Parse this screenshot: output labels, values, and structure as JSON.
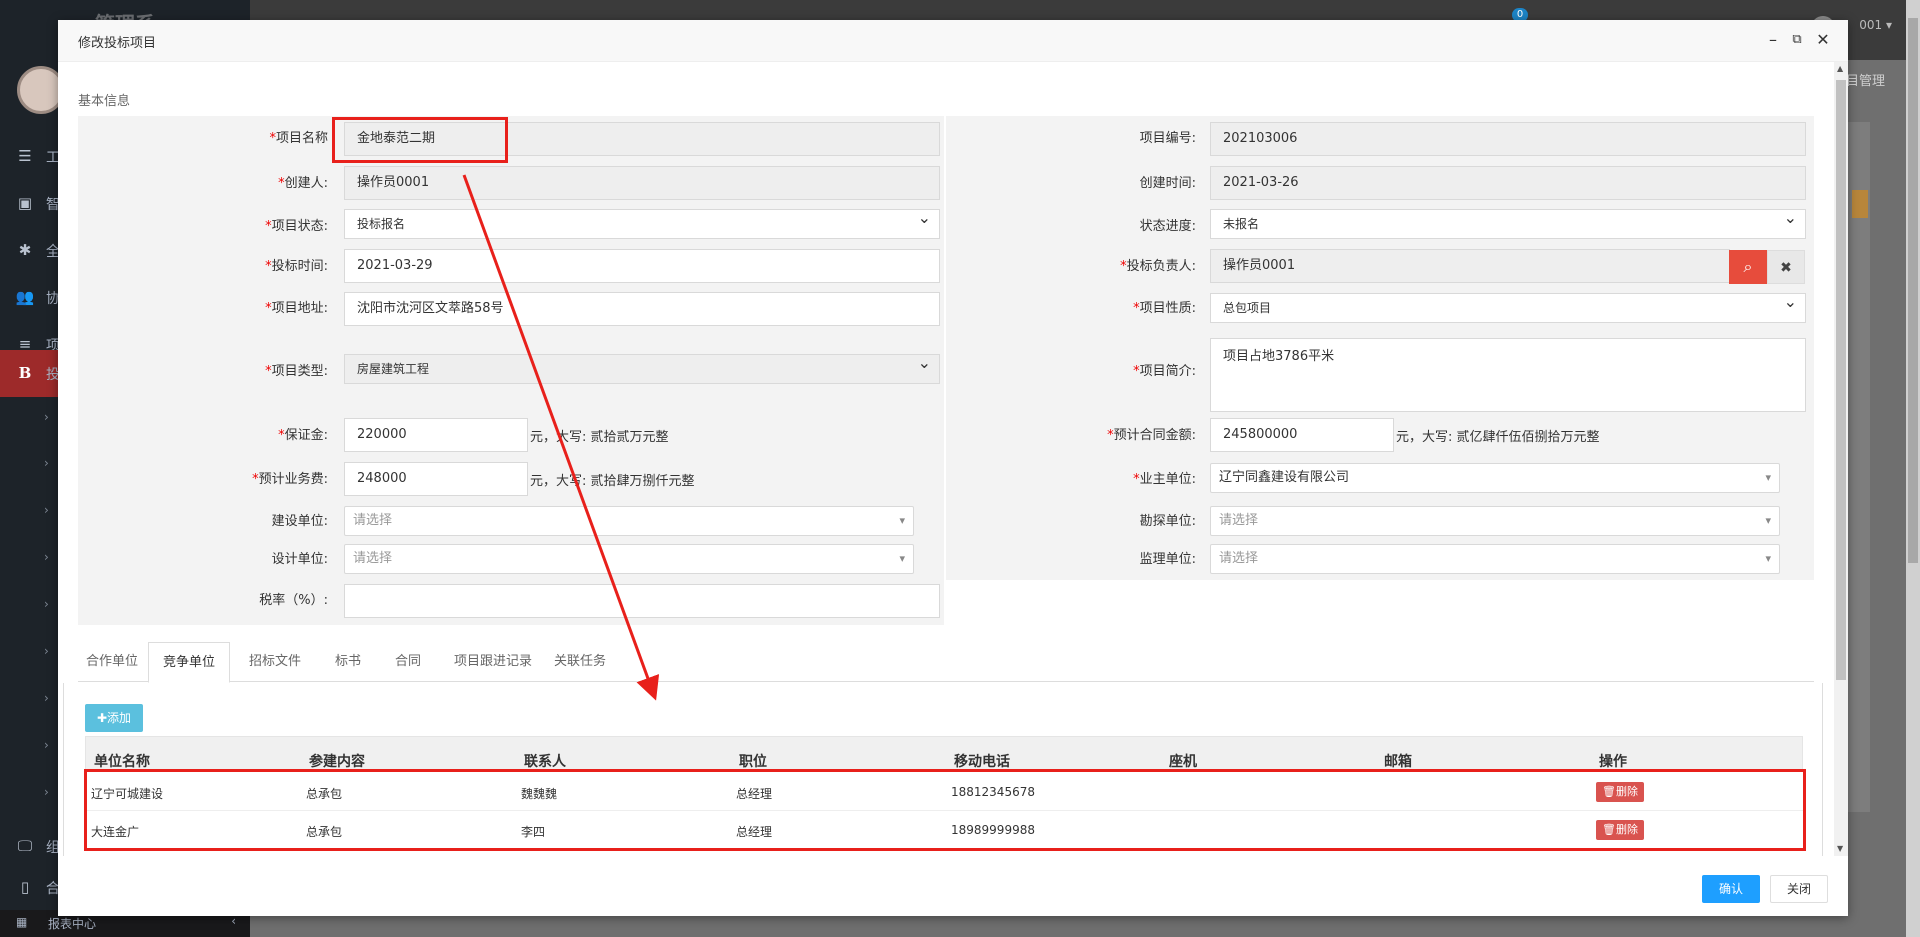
{
  "background": {
    "brand": "管理系",
    "nav": [
      {
        "icon": "☰",
        "label": "工"
      },
      {
        "icon": "▣",
        "label": "智"
      },
      {
        "icon": "✱",
        "label": "全"
      },
      {
        "icon": "👥",
        "label": "协"
      },
      {
        "icon": "≡",
        "label": "项"
      },
      {
        "icon": "B",
        "label": "投"
      }
    ],
    "nav_bottom": [
      {
        "icon": "🖵",
        "label": "组"
      },
      {
        "icon": "▯",
        "label": "合"
      }
    ],
    "report_center": "报表中心",
    "user_text": "001 ▾",
    "notif_count": "0",
    "page_tab": "目管理"
  },
  "modal": {
    "title": "修改投标项目",
    "section_title": "基本信息",
    "fields": {
      "project_name": {
        "label": "项目名称",
        "value": "金地泰范二期"
      },
      "project_no": {
        "label": "项目编号:",
        "value": "202103006"
      },
      "creator": {
        "label": "创建人:",
        "value": "操作员0001"
      },
      "created_time": {
        "label": "创建时间:",
        "value": "2021-03-26"
      },
      "project_status": {
        "label": "项目状态:",
        "value": "投标报名"
      },
      "status_progress": {
        "label": "状态进度:",
        "value": "未报名"
      },
      "bid_time": {
        "label": "投标时间:",
        "value": "2021-03-29"
      },
      "bid_owner": {
        "label": "投标负责人:",
        "value": "操作员0001"
      },
      "address": {
        "label": "项目地址:",
        "value": "沈阳市沈河区文萃路58号"
      },
      "nature": {
        "label": "项目性质:",
        "value": "总包项目"
      },
      "type": {
        "label": "项目类型:",
        "value": "房屋建筑工程"
      },
      "brief": {
        "label": "项目简介:",
        "value": "项目占地3786平米"
      },
      "deposit": {
        "label": "保证金:",
        "value": "220000",
        "hint": "元，大写: 贰拾贰万元整"
      },
      "contract_amount": {
        "label": "预计合同金额:",
        "value": "245800000",
        "hint": "元，大写: 贰亿肆仟伍佰捌拾万元整"
      },
      "service_fee": {
        "label": "预计业务费:",
        "value": "248000",
        "hint": "元，大写: 贰拾肆万捌仟元整"
      },
      "owner_unit": {
        "label": "业主单位:",
        "value": "辽宁同鑫建设有限公司"
      },
      "build_unit": {
        "label": "建设单位:",
        "placeholder": "请选择"
      },
      "survey_unit": {
        "label": "勘探单位:",
        "placeholder": "请选择"
      },
      "design_unit": {
        "label": "设计单位:",
        "placeholder": "请选择"
      },
      "supervise_unit": {
        "label": "监理单位:",
        "placeholder": "请选择"
      },
      "tax_rate": {
        "label": "税率（%）:",
        "value": ""
      }
    },
    "tabs": [
      "合作单位",
      "竞争单位",
      "招标文件",
      "标书",
      "合同",
      "项目跟进记录",
      "关联任务"
    ],
    "active_tab": "竞争单位",
    "add_button": "✚添加",
    "table": {
      "headers": [
        "单位名称",
        "参建内容",
        "联系人",
        "职位",
        "移动电话",
        "座机",
        "邮箱",
        "操作"
      ],
      "rows": [
        {
          "name": "辽宁可城建设",
          "content": "总承包",
          "contact": "魏魏魏",
          "position": "总经理",
          "mobile": "18812345678",
          "phone": "",
          "email": ""
        },
        {
          "name": "大连金广",
          "content": "总承包",
          "contact": "李四",
          "position": "总经理",
          "mobile": "18989999988",
          "phone": "",
          "email": ""
        }
      ],
      "delete_label": "🗑删除"
    },
    "ok_button": "确认",
    "close_button": "关闭"
  },
  "colors": {
    "accent": "#1e9fff",
    "danger": "#d9534f",
    "annotation": "#e8201b",
    "add": "#5bc0de"
  }
}
